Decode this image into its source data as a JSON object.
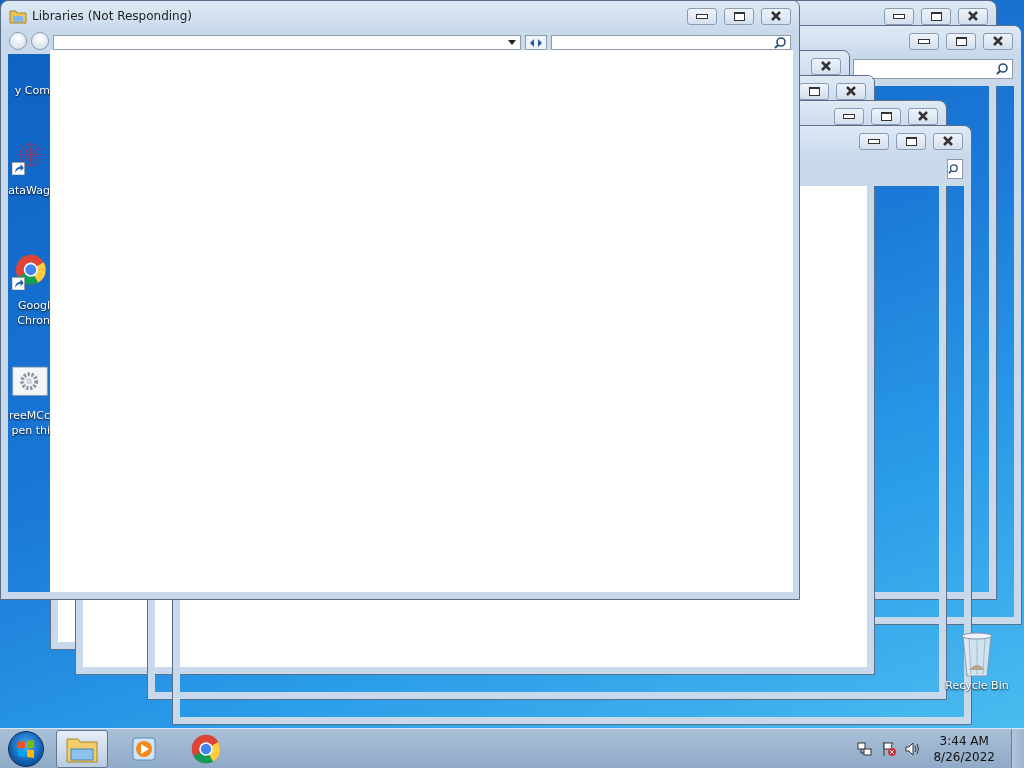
{
  "window": {
    "title": "Libraries (Not Responding)"
  },
  "desktop_icons": [
    {
      "kind": "computer",
      "lines": [
        "y Com"
      ]
    },
    {
      "kind": "network-shortcut",
      "lines": [
        "ataWag"
      ]
    },
    {
      "kind": "chrome-shortcut",
      "lines": [
        "Googl",
        "Chron"
      ]
    },
    {
      "kind": "gear-file",
      "lines": [
        "reeMCc",
        "pen thi"
      ]
    }
  ],
  "recycle_bin": {
    "label": "Recycle Bin"
  },
  "taskbar": {
    "items": [
      {
        "kind": "explorer",
        "selected": true
      },
      {
        "kind": "media-player",
        "selected": false
      },
      {
        "kind": "chrome",
        "selected": false
      }
    ],
    "clock": {
      "time": "3:44 AM",
      "date": "8/26/2022"
    }
  }
}
